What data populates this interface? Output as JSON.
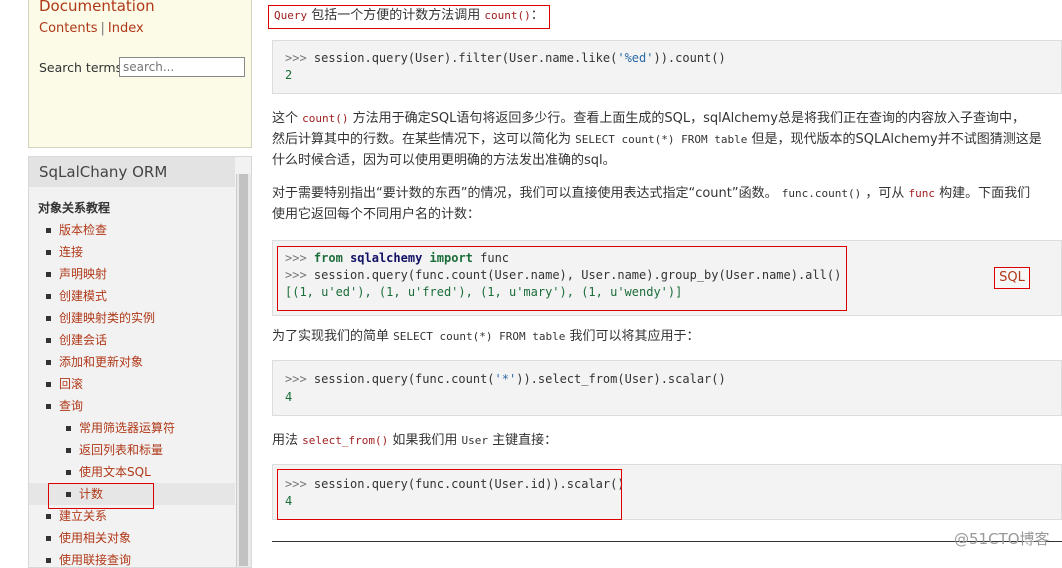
{
  "sidebar": {
    "doc_title": "Documentation",
    "contents_link": "Contents",
    "separator": "|",
    "index_link": "Index",
    "search_label": "Search terms:",
    "search_placeholder": "search...",
    "nav_title": "SqLalChany ORM",
    "section_title": "对象关系教程",
    "items": [
      {
        "label": "版本检查",
        "level": 1
      },
      {
        "label": "连接",
        "level": 1
      },
      {
        "label": "声明映射",
        "level": 1
      },
      {
        "label": "创建模式",
        "level": 1
      },
      {
        "label": "创建映射类的实例",
        "level": 1
      },
      {
        "label": "创建会话",
        "level": 1
      },
      {
        "label": "添加和更新对象",
        "level": 1
      },
      {
        "label": "回滚",
        "level": 1
      },
      {
        "label": "查询",
        "level": 1
      },
      {
        "label": "常用筛选器运算符",
        "level": 2
      },
      {
        "label": "返回列表和标量",
        "level": 2
      },
      {
        "label": "使用文本SQL",
        "level": 2
      },
      {
        "label": "计数",
        "level": 2,
        "current": true
      },
      {
        "label": "建立关系",
        "level": 1
      },
      {
        "label": "使用相关对象",
        "level": 1
      },
      {
        "label": "使用联接查询",
        "level": 1
      }
    ]
  },
  "main": {
    "intro": {
      "code1": "Query",
      "text": " 包括一个方便的计数方法调用 ",
      "code2": "count()",
      "end": "："
    },
    "code1": {
      "prompt": ">>>",
      "line": " session.query(User).filter(User.name.like(",
      "str": "'%ed'",
      "rest": ")).count()",
      "output": "2"
    },
    "para1": {
      "l1a": "这个 ",
      "l1code": "count()",
      "l1b": " 方法用于确定SQL语句将返回多少行。查看上面生成的SQL，sqlAlchemy总是将我们正在查询的内容放入子查询中，",
      "l2a": "然后计算其中的行数。在某些情况下，这可以简化为 ",
      "l2code": "SELECT count(*) FROM table",
      "l2b": " 但是，现代版本的SQLAlchemy并不试图猜测这是",
      "l3": "什么时候合适，因为可以使用更明确的方法发出准确的sql。"
    },
    "para2": {
      "l1a": "对于需要特别指出“要计数的东西”的情况，我们可以直接使用表达式指定“count”函数。 ",
      "l1code": "func.count()",
      "l1b": " ，可从 ",
      "l1code2": "func",
      "l1c": " 构建。下面我们",
      "l2": "使用它返回每个不同用户名的计数："
    },
    "code2": {
      "prompt": ">>>",
      "kw_from": "from",
      "module": "sqlalchemy",
      "kw_import": "import",
      "name": " func",
      "line2": " session.query(func.count(User.name), User.name).group_by(User.name).all()",
      "output": "[(1, u'ed'), (1, u'fred'), (1, u'mary'), (1, u'wendy')]",
      "sql_button": "SQL"
    },
    "para3": {
      "a": "为了实现我们的简单 ",
      "code": "SELECT count(*) FROM table",
      "b": " 我们可以将其应用于："
    },
    "code3": {
      "prompt": ">>>",
      "line": " session.query(func.count(",
      "str": "'*'",
      "rest": ")).select_from(User).scalar()",
      "output": "4"
    },
    "para4": {
      "a": "用法 ",
      "code": "select_from()",
      "b": " 如果我们用 ",
      "code2": "User",
      "c": " 主键直接："
    },
    "code4": {
      "prompt": ">>>",
      "line": " session.query(func.count(User.id)).scalar()",
      "output": "4"
    },
    "watermark": "@51CTO博客"
  }
}
